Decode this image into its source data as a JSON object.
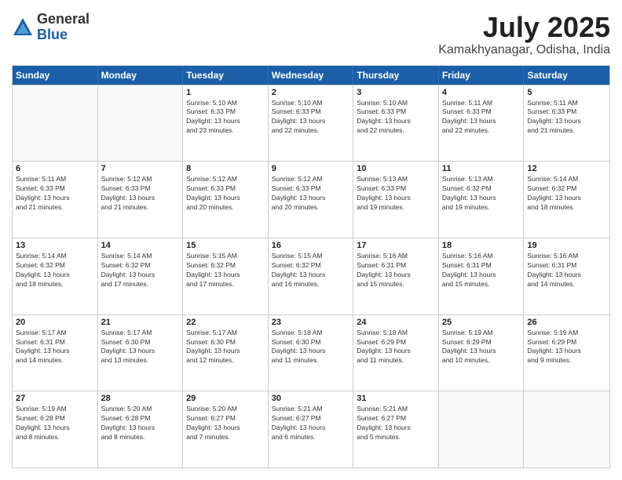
{
  "header": {
    "logo_general": "General",
    "logo_blue": "Blue",
    "month_title": "July 2025",
    "location": "Kamakhyanagar, Odisha, India"
  },
  "days_of_week": [
    "Sunday",
    "Monday",
    "Tuesday",
    "Wednesday",
    "Thursday",
    "Friday",
    "Saturday"
  ],
  "weeks": [
    [
      {
        "day": "",
        "info": "",
        "empty": true
      },
      {
        "day": "",
        "info": "",
        "empty": true
      },
      {
        "day": "1",
        "info": "Sunrise: 5:10 AM\nSunset: 6:33 PM\nDaylight: 13 hours\nand 23 minutes."
      },
      {
        "day": "2",
        "info": "Sunrise: 5:10 AM\nSunset: 6:33 PM\nDaylight: 13 hours\nand 22 minutes."
      },
      {
        "day": "3",
        "info": "Sunrise: 5:10 AM\nSunset: 6:33 PM\nDaylight: 13 hours\nand 22 minutes."
      },
      {
        "day": "4",
        "info": "Sunrise: 5:11 AM\nSunset: 6:33 PM\nDaylight: 13 hours\nand 22 minutes."
      },
      {
        "day": "5",
        "info": "Sunrise: 5:11 AM\nSunset: 6:33 PM\nDaylight: 13 hours\nand 21 minutes."
      }
    ],
    [
      {
        "day": "6",
        "info": "Sunrise: 5:11 AM\nSunset: 6:33 PM\nDaylight: 13 hours\nand 21 minutes."
      },
      {
        "day": "7",
        "info": "Sunrise: 5:12 AM\nSunset: 6:33 PM\nDaylight: 13 hours\nand 21 minutes."
      },
      {
        "day": "8",
        "info": "Sunrise: 5:12 AM\nSunset: 6:33 PM\nDaylight: 13 hours\nand 20 minutes."
      },
      {
        "day": "9",
        "info": "Sunrise: 5:12 AM\nSunset: 6:33 PM\nDaylight: 13 hours\nand 20 minutes."
      },
      {
        "day": "10",
        "info": "Sunrise: 5:13 AM\nSunset: 6:33 PM\nDaylight: 13 hours\nand 19 minutes."
      },
      {
        "day": "11",
        "info": "Sunrise: 5:13 AM\nSunset: 6:32 PM\nDaylight: 13 hours\nand 19 minutes."
      },
      {
        "day": "12",
        "info": "Sunrise: 5:14 AM\nSunset: 6:32 PM\nDaylight: 13 hours\nand 18 minutes."
      }
    ],
    [
      {
        "day": "13",
        "info": "Sunrise: 5:14 AM\nSunset: 6:32 PM\nDaylight: 13 hours\nand 18 minutes."
      },
      {
        "day": "14",
        "info": "Sunrise: 5:14 AM\nSunset: 6:32 PM\nDaylight: 13 hours\nand 17 minutes."
      },
      {
        "day": "15",
        "info": "Sunrise: 5:15 AM\nSunset: 6:32 PM\nDaylight: 13 hours\nand 17 minutes."
      },
      {
        "day": "16",
        "info": "Sunrise: 5:15 AM\nSunset: 6:32 PM\nDaylight: 13 hours\nand 16 minutes."
      },
      {
        "day": "17",
        "info": "Sunrise: 5:16 AM\nSunset: 6:31 PM\nDaylight: 13 hours\nand 15 minutes."
      },
      {
        "day": "18",
        "info": "Sunrise: 5:16 AM\nSunset: 6:31 PM\nDaylight: 13 hours\nand 15 minutes."
      },
      {
        "day": "19",
        "info": "Sunrise: 5:16 AM\nSunset: 6:31 PM\nDaylight: 13 hours\nand 14 minutes."
      }
    ],
    [
      {
        "day": "20",
        "info": "Sunrise: 5:17 AM\nSunset: 6:31 PM\nDaylight: 13 hours\nand 14 minutes."
      },
      {
        "day": "21",
        "info": "Sunrise: 5:17 AM\nSunset: 6:30 PM\nDaylight: 13 hours\nand 13 minutes."
      },
      {
        "day": "22",
        "info": "Sunrise: 5:17 AM\nSunset: 6:30 PM\nDaylight: 13 hours\nand 12 minutes."
      },
      {
        "day": "23",
        "info": "Sunrise: 5:18 AM\nSunset: 6:30 PM\nDaylight: 13 hours\nand 11 minutes."
      },
      {
        "day": "24",
        "info": "Sunrise: 5:18 AM\nSunset: 6:29 PM\nDaylight: 13 hours\nand 11 minutes."
      },
      {
        "day": "25",
        "info": "Sunrise: 5:19 AM\nSunset: 6:29 PM\nDaylight: 13 hours\nand 10 minutes."
      },
      {
        "day": "26",
        "info": "Sunrise: 5:19 AM\nSunset: 6:29 PM\nDaylight: 13 hours\nand 9 minutes."
      }
    ],
    [
      {
        "day": "27",
        "info": "Sunrise: 5:19 AM\nSunset: 6:28 PM\nDaylight: 13 hours\nand 8 minutes."
      },
      {
        "day": "28",
        "info": "Sunrise: 5:20 AM\nSunset: 6:28 PM\nDaylight: 13 hours\nand 8 minutes."
      },
      {
        "day": "29",
        "info": "Sunrise: 5:20 AM\nSunset: 6:27 PM\nDaylight: 13 hours\nand 7 minutes."
      },
      {
        "day": "30",
        "info": "Sunrise: 5:21 AM\nSunset: 6:27 PM\nDaylight: 13 hours\nand 6 minutes."
      },
      {
        "day": "31",
        "info": "Sunrise: 5:21 AM\nSunset: 6:27 PM\nDaylight: 13 hours\nand 5 minutes."
      },
      {
        "day": "",
        "info": "",
        "empty": true
      },
      {
        "day": "",
        "info": "",
        "empty": true
      }
    ]
  ]
}
